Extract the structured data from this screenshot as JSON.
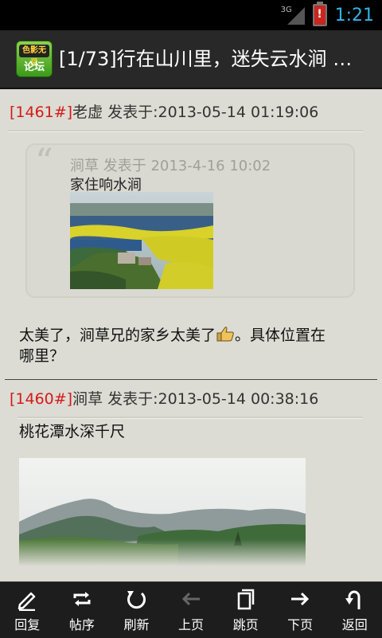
{
  "status": {
    "network": "3G",
    "battery_alert": "!",
    "time": "1:21"
  },
  "app": {
    "logo_top": "色影无忌",
    "logo_bottom": "论坛",
    "title": "[1/73]行在山川里，迷失云水涧 …"
  },
  "posts": [
    {
      "number": "[1461#]",
      "author_line": "老虚 发表于:2013-05-14 01:19:06",
      "quote": {
        "meta": "涧草 发表于 2013-4-16 10:02",
        "text": "家住响水涧"
      },
      "text_before": "太美了，涧草兄的家乡太美了",
      "text_after": "。具体位置在",
      "text_line2": "哪里？"
    },
    {
      "number": "[1460#]",
      "author_line": "涧草 发表于:2013-05-14 00:38:16",
      "text": "桃花潭水深千尺"
    }
  ],
  "toolbar": {
    "items": [
      {
        "label": "回复",
        "icon": "pencil-icon"
      },
      {
        "label": "帖序",
        "icon": "repeat-icon"
      },
      {
        "label": "刷新",
        "icon": "refresh-icon"
      },
      {
        "label": "上页",
        "icon": "arrow-left-icon"
      },
      {
        "label": "跳页",
        "icon": "pages-icon"
      },
      {
        "label": "下页",
        "icon": "arrow-right-icon"
      },
      {
        "label": "返回",
        "icon": "back-icon"
      }
    ]
  },
  "colors": {
    "accent_clock": "#33b5e5",
    "post_number": "#d41a1a",
    "background": "#dcdcd4"
  }
}
